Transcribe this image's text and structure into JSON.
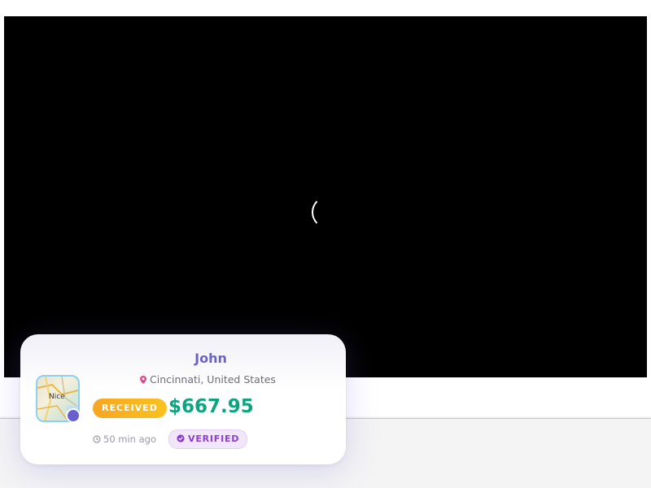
{
  "video": {
    "state": "loading"
  },
  "notification": {
    "name": "John",
    "location": "Cincinnati, United States",
    "status_badge": "RECEIVED",
    "amount": "$667.95",
    "time_ago": "50 min ago",
    "verified_badge": "VERIFIED",
    "avatar_map_label": "Nice",
    "colors": {
      "name": "#6b63c8",
      "amount": "#10a37f",
      "received_badge": "#f6a623",
      "verified_text": "#8a3fd1",
      "verified_bg": "#f1e6fa",
      "online_dot": "#6a5fd0",
      "pin": "#e0478a"
    },
    "icons": {
      "location": "map-pin-icon",
      "time": "clock-icon",
      "verified": "check-circle-icon",
      "spinner": "loading-spinner-icon"
    }
  }
}
